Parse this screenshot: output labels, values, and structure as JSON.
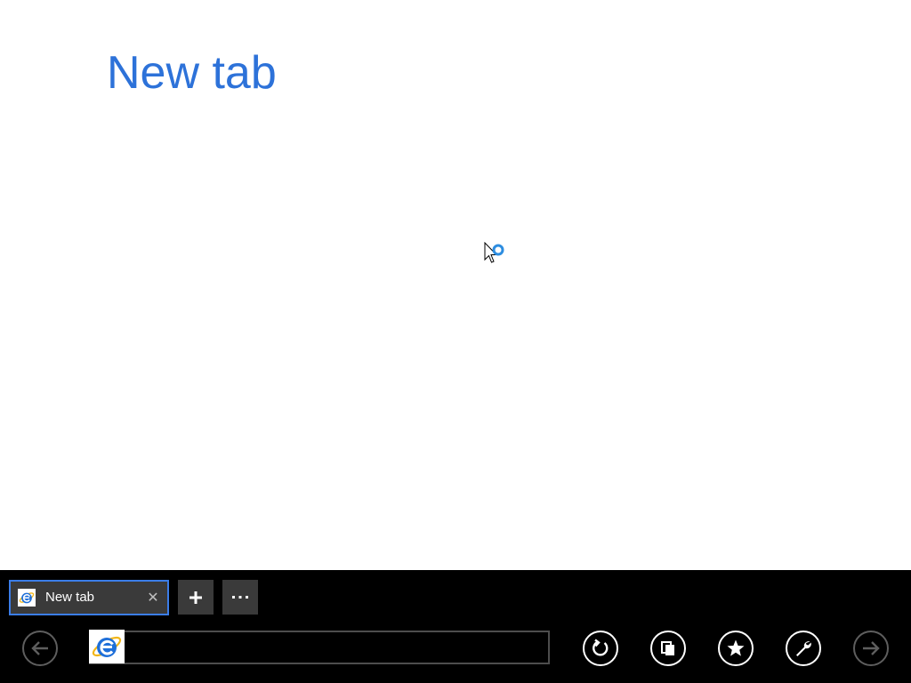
{
  "page": {
    "title": "New tab"
  },
  "tabs": [
    {
      "label": "New tab",
      "active": true,
      "favicon": "ie-icon"
    }
  ],
  "tab_bar": {
    "new_tab_icon": "plus-icon",
    "tab_tools_icon": "ellipsis-icon",
    "new_tab_symbol": "+",
    "tools_symbol": "···",
    "close_symbol": "✕"
  },
  "nav_bar": {
    "address_value": "",
    "address_placeholder": "",
    "address_icon": "ie-icon",
    "buttons": [
      {
        "name": "back",
        "icon": "arrow-left-icon",
        "enabled": false
      },
      {
        "name": "refresh",
        "icon": "refresh-icon",
        "enabled": true
      },
      {
        "name": "pin",
        "icon": "pin-icon",
        "enabled": true
      },
      {
        "name": "favorites",
        "icon": "star-icon",
        "enabled": true
      },
      {
        "name": "tools",
        "icon": "wrench-icon",
        "enabled": true
      },
      {
        "name": "forward",
        "icon": "arrow-right-icon",
        "enabled": false
      }
    ]
  },
  "colors": {
    "accent": "#2d72d9",
    "tab_border": "#3b7de8",
    "appbar_bg": "#000000",
    "button_bg": "#3a3a3a",
    "disabled": "#5e5e5e"
  }
}
